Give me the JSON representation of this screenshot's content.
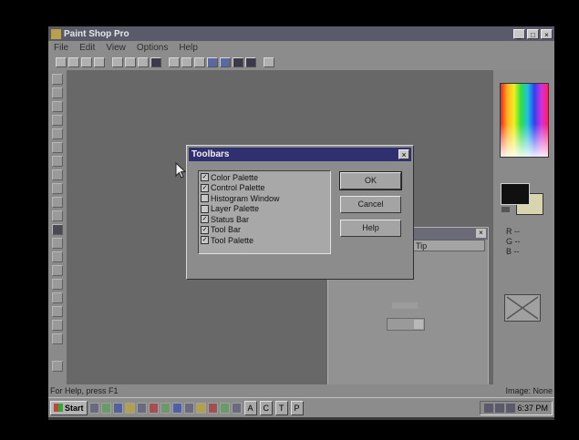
{
  "app": {
    "title": "Paint Shop Pro",
    "window_buttons": [
      "_",
      "□",
      "×"
    ]
  },
  "menu": [
    "File",
    "Edit",
    "View",
    "Options",
    "Help"
  ],
  "right_panel": {
    "rgb": [
      "R --",
      "G --",
      "B --"
    ]
  },
  "background_window": {
    "close": "×",
    "tab_label": "Tip"
  },
  "dialog": {
    "title": "Toolbars",
    "close": "×",
    "items": [
      {
        "label": "Color Palette",
        "checked": true
      },
      {
        "label": "Control Palette",
        "checked": true
      },
      {
        "label": "Histogram Window",
        "checked": false
      },
      {
        "label": "Layer Palette",
        "checked": false
      },
      {
        "label": "Status Bar",
        "checked": true
      },
      {
        "label": "Tool Bar",
        "checked": true
      },
      {
        "label": "Tool Palette",
        "checked": true
      }
    ],
    "buttons": {
      "ok": "OK",
      "cancel": "Cancel",
      "help": "Help"
    }
  },
  "status": {
    "left": "For Help, press F1",
    "right": "Image: None"
  },
  "taskbar": {
    "start": "Start",
    "buttons": [
      "A",
      "C",
      "T",
      "P"
    ],
    "time": "6:37 PM"
  }
}
